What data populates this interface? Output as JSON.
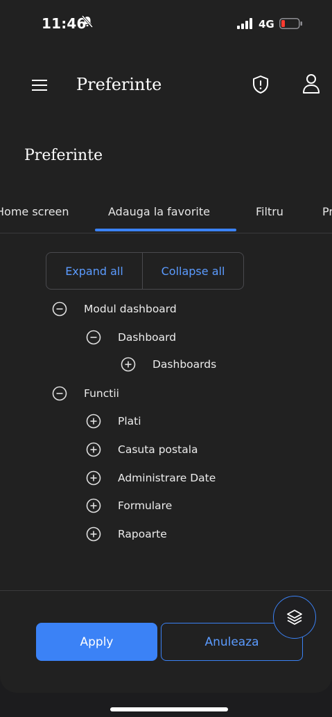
{
  "status_bar": {
    "time": "11:46",
    "network": "4G",
    "battery_color": "#ff3b30"
  },
  "appbar": {
    "title": "Preferinte",
    "menu_icon": "hamburger-icon",
    "shield_icon": "shield-alert-icon",
    "user_icon": "user-icon"
  },
  "page": {
    "title": "Preferinte"
  },
  "tabs": [
    {
      "label": "Home screen",
      "active": false
    },
    {
      "label": "Adauga la favorite",
      "active": true
    },
    {
      "label": "Filtru",
      "active": false
    },
    {
      "label": "Pr",
      "active": false
    }
  ],
  "tree": {
    "expand_all": "Expand all",
    "collapse_all": "Collapse all",
    "nodes": [
      {
        "label": "Modul dashboard",
        "level": 0,
        "state": "expanded"
      },
      {
        "label": "Dashboard",
        "level": 1,
        "state": "expanded"
      },
      {
        "label": "Dashboards",
        "level": 2,
        "state": "collapsed"
      },
      {
        "label": "Functii",
        "level": 0,
        "state": "expanded"
      },
      {
        "label": "Plati",
        "level": 1,
        "state": "collapsed"
      },
      {
        "label": "Casuta postala",
        "level": 1,
        "state": "collapsed"
      },
      {
        "label": "Administrare Date",
        "level": 1,
        "state": "collapsed"
      },
      {
        "label": "Formulare",
        "level": 1,
        "state": "collapsed"
      },
      {
        "label": "Rapoarte",
        "level": 1,
        "state": "collapsed"
      }
    ]
  },
  "footer": {
    "apply_label": "Apply",
    "cancel_label": "Anuleaza",
    "fab_icon": "layers-icon"
  },
  "colors": {
    "accent": "#3b82f6",
    "background": "#212121"
  }
}
